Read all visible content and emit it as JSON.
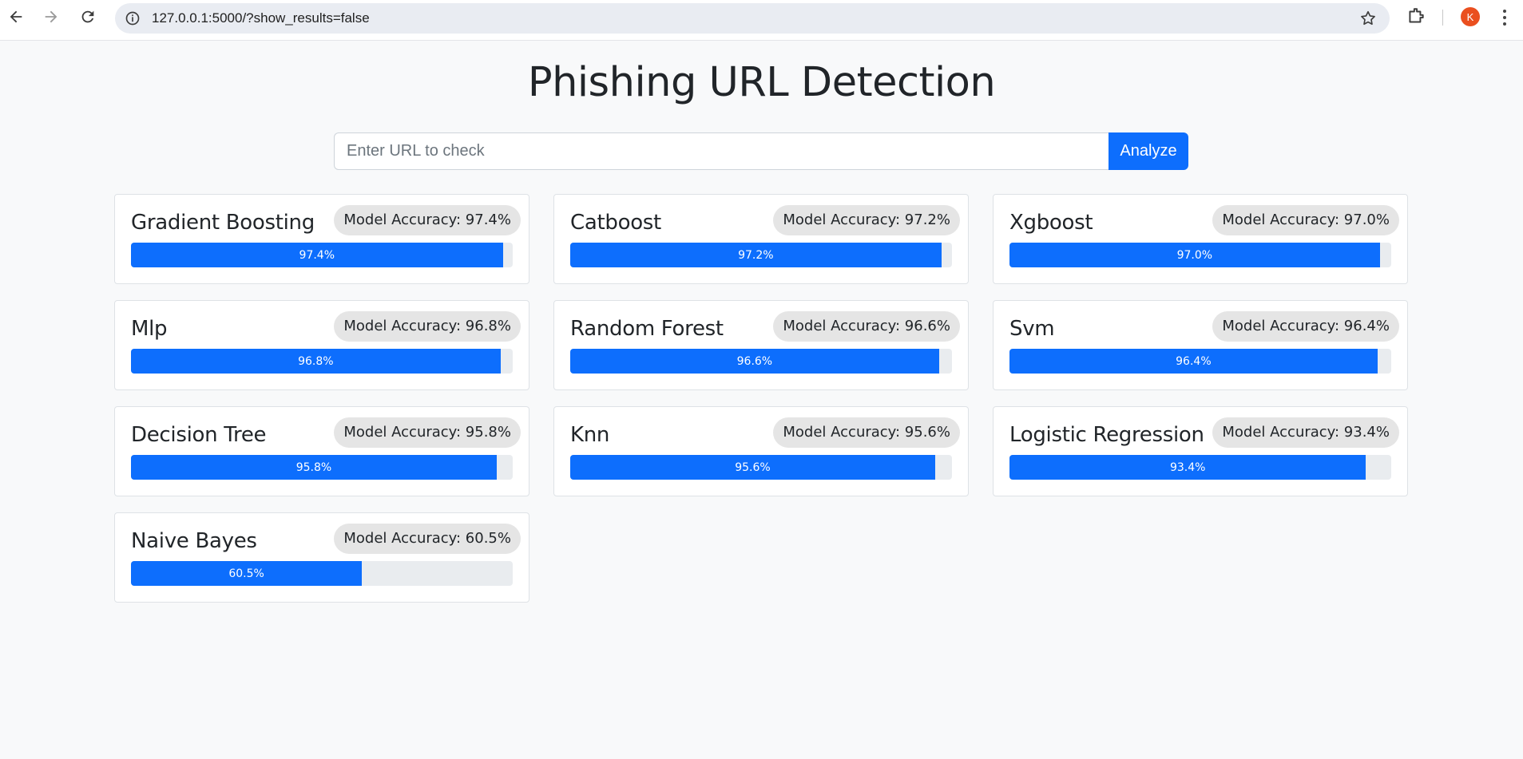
{
  "browser": {
    "url": "127.0.0.1:5000/?show_results=false",
    "avatar_initial": "K"
  },
  "page": {
    "title": "Phishing URL Detection"
  },
  "search": {
    "placeholder": "Enter URL to check",
    "value": "",
    "button_label": "Analyze"
  },
  "accent_color": "#0d6efd",
  "models": [
    {
      "name": "Gradient Boosting",
      "badge": "Model Accuracy: 97.4%",
      "bar_label": "97.4%",
      "accuracy": 97.4
    },
    {
      "name": "Catboost",
      "badge": "Model Accuracy: 97.2%",
      "bar_label": "97.2%",
      "accuracy": 97.2
    },
    {
      "name": "Xgboost",
      "badge": "Model Accuracy: 97.0%",
      "bar_label": "97.0%",
      "accuracy": 97.0
    },
    {
      "name": "Mlp",
      "badge": "Model Accuracy: 96.8%",
      "bar_label": "96.8%",
      "accuracy": 96.8
    },
    {
      "name": "Random Forest",
      "badge": "Model Accuracy: 96.6%",
      "bar_label": "96.6%",
      "accuracy": 96.6
    },
    {
      "name": "Svm",
      "badge": "Model Accuracy: 96.4%",
      "bar_label": "96.4%",
      "accuracy": 96.4
    },
    {
      "name": "Decision Tree",
      "badge": "Model Accuracy: 95.8%",
      "bar_label": "95.8%",
      "accuracy": 95.8
    },
    {
      "name": "Knn",
      "badge": "Model Accuracy: 95.6%",
      "bar_label": "95.6%",
      "accuracy": 95.6
    },
    {
      "name": "Logistic Regression",
      "badge": "Model Accuracy: 93.4%",
      "bar_label": "93.4%",
      "accuracy": 93.4
    },
    {
      "name": "Naive Bayes",
      "badge": "Model Accuracy: 60.5%",
      "bar_label": "60.5%",
      "accuracy": 60.5
    }
  ]
}
